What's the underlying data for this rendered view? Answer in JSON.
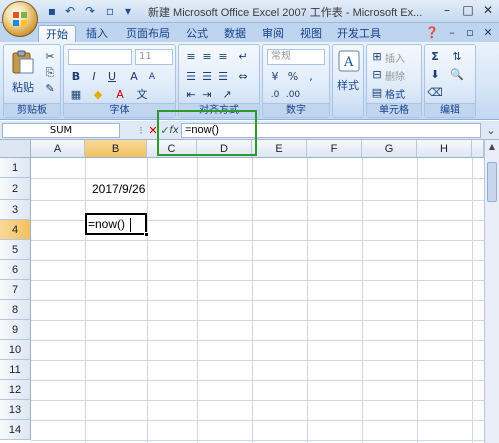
{
  "title_bar": {
    "title": "新建 Microsoft Office Excel 2007 工作表 - Microsoft Ex...",
    "minimize": "–",
    "maximize": "□",
    "close": "✕"
  },
  "quick_access": {
    "save_icon": "save-icon",
    "undo_icon": "undo-icon",
    "redo_icon": "redo-icon"
  },
  "tabs": [
    "开始",
    "插入",
    "页面布局",
    "公式",
    "数据",
    "审阅",
    "视图",
    "开发工具"
  ],
  "ribbon": {
    "clipboard": {
      "paste_label": "粘贴",
      "group_label": "剪贴板"
    },
    "font": {
      "font_size": "11",
      "bold": "B",
      "italic": "I",
      "underline": "U",
      "group_label": "字体"
    },
    "alignment": {
      "group_label": "对齐方式"
    },
    "number": {
      "format": "常规",
      "group_label": "数字"
    },
    "styles": {
      "label": "样式"
    },
    "cells": {
      "insert": "插入",
      "delete": "删除",
      "format": "格式",
      "group_label": "单元格"
    },
    "editing": {
      "group_label": "编辑"
    }
  },
  "formula_bar": {
    "name_box": "SUM",
    "cancel": "✕",
    "enter": "✓",
    "fx": "fx",
    "formula": "=now()"
  },
  "columns": [
    "A",
    "B",
    "C",
    "D",
    "E",
    "F",
    "G",
    "H"
  ],
  "rows": [
    "1",
    "2",
    "3",
    "4",
    "5",
    "6",
    "7",
    "8",
    "9",
    "10",
    "11",
    "12",
    "13",
    "14"
  ],
  "cells": {
    "B2": "2017/9/26",
    "B4": "=now()"
  },
  "colors": {
    "highlight": "#2e9a2e",
    "selected_header": "#f1c15f"
  }
}
